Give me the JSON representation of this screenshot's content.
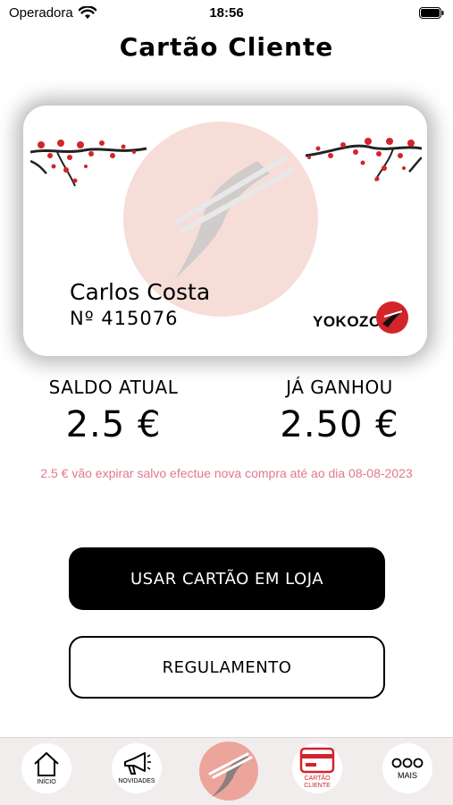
{
  "status_bar": {
    "carrier": "Operadora",
    "time": "18:56"
  },
  "header": {
    "title": "Cartão Cliente"
  },
  "card": {
    "holder_name": "Carlos Costa",
    "number": "Nº 415076",
    "brand": "YOKOZO"
  },
  "balance": {
    "current_label": "SALDO ATUAL",
    "current_value": "2.5 €",
    "earned_label": "JÁ GANHOU",
    "earned_value": "2.50 €",
    "expiry_note": "2.5 € vão expirar salvo efectue nova compra até ao dia 08-08-2023"
  },
  "actions": {
    "use_card_label": "USAR CARTÃO EM LOJA",
    "rules_label": "REGULAMENTO"
  },
  "tab_bar": {
    "home_label": "INÍCIO",
    "news_label": "NOVIDADES",
    "card_label": "CARTÃO\nCLIENTE",
    "more_label": "MAIS"
  },
  "colors": {
    "accent_red": "#d3242c",
    "note_pink": "#e1788d",
    "brand_salmon": "#eca59b",
    "tab_bar_bg": "#f1eded"
  },
  "icons": [
    "wifi-icon",
    "battery-icon",
    "home-icon",
    "megaphone-icon",
    "bird-logo-icon",
    "card-icon",
    "more-dots-icon"
  ]
}
